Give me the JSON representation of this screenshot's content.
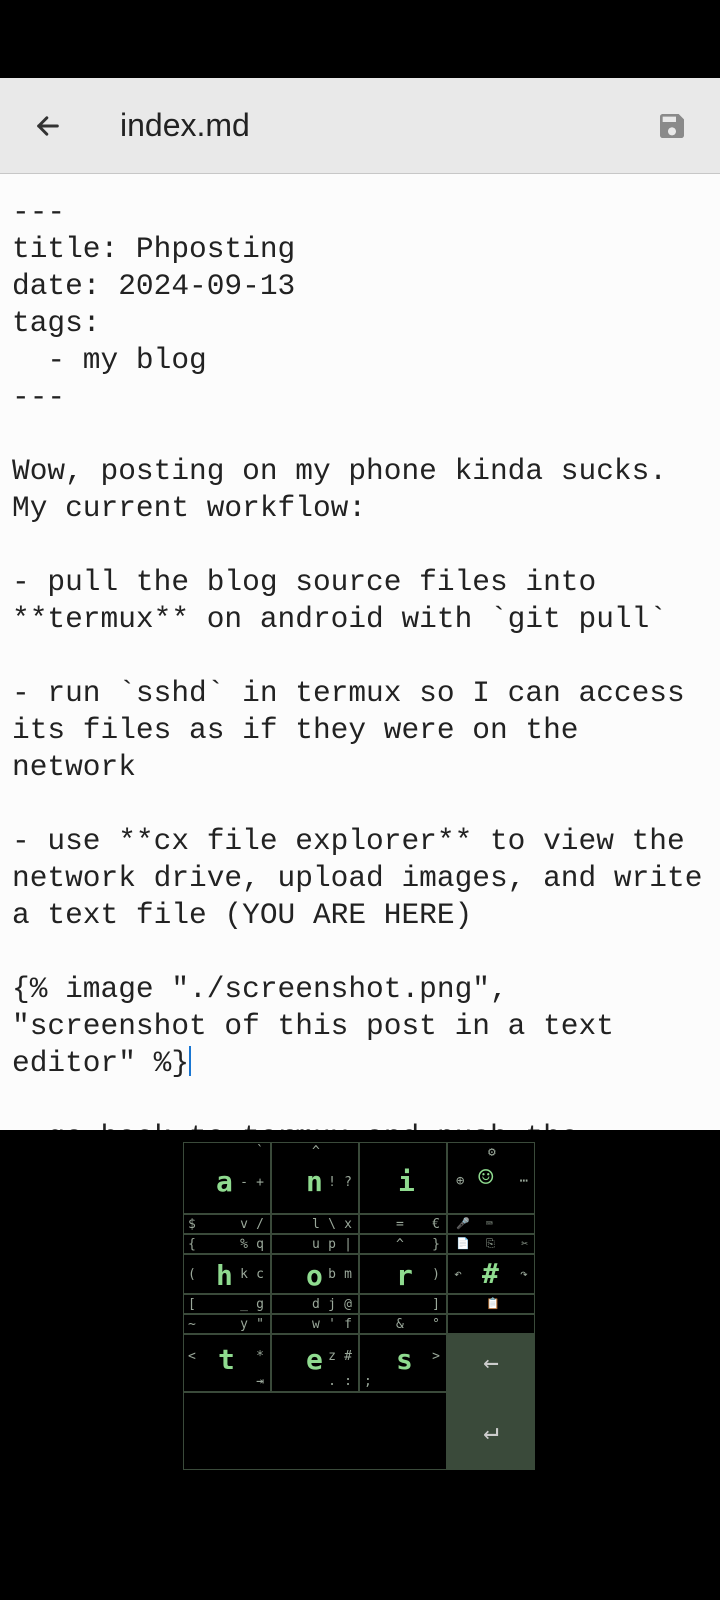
{
  "appbar": {
    "title": "index.md"
  },
  "editor": {
    "content": "---\ntitle: Phposting\ndate: 2024-09-13\ntags:\n  - my blog\n---\n\nWow, posting on my phone kinda sucks. My current workflow:\n\n- pull the blog source files into **termux** on android with `git pull`\n\n- run `sshd` in termux so I can access its files as if they were on the network\n\n- use **cx file explorer** to view the network drive, upload images, and write a text file (YOU ARE HERE)\n\n{% image \"./screenshot.png\", \"screenshot of this post in a text editor\" %}",
    "content_after": "\n\n- go back to termux and push the updated files"
  },
  "keyboard": {
    "keys": {
      "r1_main": [
        "a",
        "n",
        "i"
      ],
      "r2_main": [
        "h",
        "o",
        "r"
      ],
      "r3_main": [
        "t",
        "e",
        "s"
      ],
      "r1_c1_sub": [
        "-",
        "+"
      ],
      "r1_c2_sub": [
        "!",
        "?"
      ],
      "r1_top_c2": "^",
      "r1_top_c1": "`",
      "r1_c4_globe": "⊕",
      "r1_c4_smile": "☺",
      "r1_c4_dots": "⋯",
      "mid1_l": [
        "$",
        "v",
        "/"
      ],
      "mid1_c": [
        "l",
        "\\",
        "x"
      ],
      "mid1_r": [
        "=",
        "€"
      ],
      "mid1_icons": [
        "🎤",
        "⌨",
        ""
      ],
      "mid2_l": [
        "{",
        "%",
        "q"
      ],
      "mid2_c": [
        "u",
        "p",
        "|"
      ],
      "mid2_r": [
        "^",
        "}"
      ],
      "mid2_icons": [
        "📋",
        "✂"
      ],
      "r2_c1_sub": [
        "(",
        "k",
        "c"
      ],
      "r2_c2_sub": [
        "b",
        "m"
      ],
      "r2_c3_sub": [
        ")"
      ],
      "r2_c4_hash": "#",
      "r2_c4_sub": [
        "↶",
        "↷"
      ],
      "mid3_l": [
        "[",
        "_",
        "g"
      ],
      "mid3_c": [
        "d",
        "j",
        "@"
      ],
      "mid3_r": [
        "]"
      ],
      "mid3_icons": [
        "📋"
      ],
      "mid4_l": [
        "~",
        "y",
        "\""
      ],
      "mid4_c": [
        "w",
        "'",
        "f"
      ],
      "mid4_r": [
        "&",
        "°"
      ],
      "r3_c1_sub": [
        "<",
        "*"
      ],
      "r3_c2_sub": [
        "z",
        "#"
      ],
      "r3_c3_sub": [
        ">"
      ],
      "r3_back": "←",
      "bot_l": [
        "→"
      ],
      "bot_c": [
        ".",
        ":",
        ";"
      ],
      "enter": "↵"
    }
  }
}
